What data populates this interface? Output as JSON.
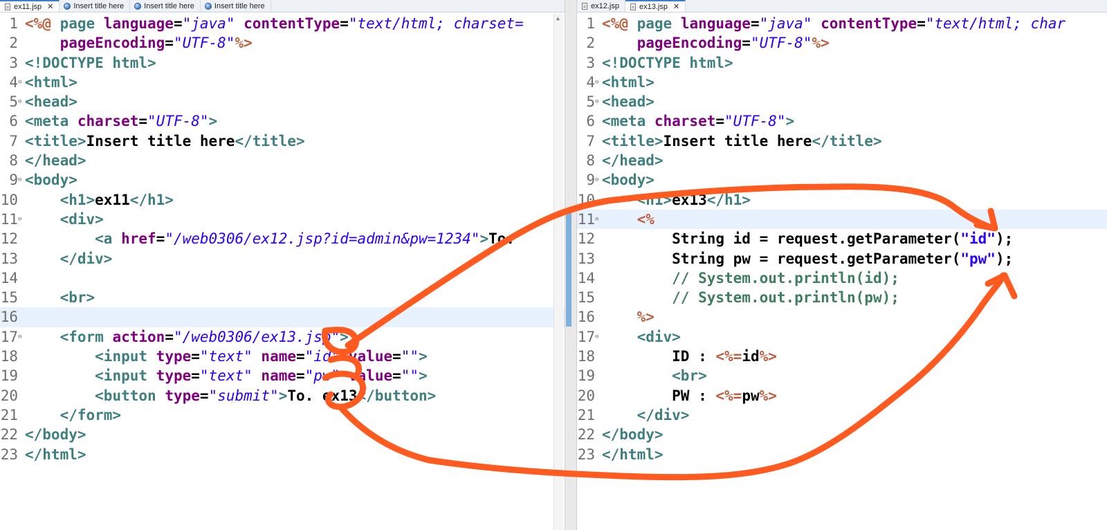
{
  "left_tabs": [
    {
      "label": "ex11.jsp",
      "icon": "jsp-file-icon",
      "active": true,
      "closable": true
    },
    {
      "label": "Insert title here",
      "icon": "browser-globe-icon"
    },
    {
      "label": "Insert title here",
      "icon": "browser-globe-icon"
    },
    {
      "label": "Insert title here",
      "icon": "browser-globe-icon"
    }
  ],
  "right_tabs": [
    {
      "label": "ex12.jsp",
      "icon": "jsp-file-icon"
    },
    {
      "label": "ex13.jsp",
      "icon": "jsp-file-icon",
      "active": true,
      "closable": true
    }
  ],
  "left_editor": {
    "highlight_line": 16,
    "lines": [
      {
        "n": "1",
        "fold": false,
        "tokens": [
          [
            "jsp",
            "<%@ "
          ],
          [
            "tg",
            "page "
          ],
          [
            "at",
            "language"
          ],
          [
            "tx",
            "="
          ],
          [
            "sv",
            "\"java\""
          ],
          [
            "tx",
            " "
          ],
          [
            "at",
            "contentType"
          ],
          [
            "tx",
            "="
          ],
          [
            "sv",
            "\"text/html; charset="
          ]
        ]
      },
      {
        "n": "2",
        "fold": false,
        "tokens": [
          [
            "tx",
            "    "
          ],
          [
            "at",
            "pageEncoding"
          ],
          [
            "tx",
            "="
          ],
          [
            "sv",
            "\"UTF-8\""
          ],
          [
            "jsp",
            "%>"
          ]
        ]
      },
      {
        "n": "3",
        "fold": false,
        "tokens": [
          [
            "tg",
            "<!DOCTYPE html>"
          ]
        ]
      },
      {
        "n": "4",
        "fold": true,
        "tokens": [
          [
            "tg",
            "<html>"
          ]
        ]
      },
      {
        "n": "5",
        "fold": true,
        "tokens": [
          [
            "tg",
            "<head>"
          ]
        ]
      },
      {
        "n": "6",
        "fold": false,
        "tokens": [
          [
            "tg",
            "<meta "
          ],
          [
            "at",
            "charset"
          ],
          [
            "tx",
            "="
          ],
          [
            "sv",
            "\"UTF-8\""
          ],
          [
            "tg",
            ">"
          ]
        ]
      },
      {
        "n": "7",
        "fold": false,
        "tokens": [
          [
            "tg",
            "<title>"
          ],
          [
            "tx",
            "Insert title here"
          ],
          [
            "tg",
            "</title>"
          ]
        ]
      },
      {
        "n": "8",
        "fold": false,
        "tokens": [
          [
            "tg",
            "</head>"
          ]
        ]
      },
      {
        "n": "9",
        "fold": true,
        "tokens": [
          [
            "tg",
            "<body>"
          ]
        ]
      },
      {
        "n": "10",
        "fold": false,
        "tokens": [
          [
            "tx",
            "    "
          ],
          [
            "tg",
            "<h1>"
          ],
          [
            "tx",
            "ex11"
          ],
          [
            "tg",
            "</h1>"
          ]
        ]
      },
      {
        "n": "11",
        "fold": true,
        "tokens": [
          [
            "tx",
            "    "
          ],
          [
            "tg",
            "<div>"
          ]
        ]
      },
      {
        "n": "12",
        "fold": false,
        "tokens": [
          [
            "tx",
            "        "
          ],
          [
            "tg",
            "<a "
          ],
          [
            "at",
            "href"
          ],
          [
            "tx",
            "="
          ],
          [
            "sv",
            "\"/web0306/ex12.jsp?id=admin&pw=1234\""
          ],
          [
            "tg",
            ">"
          ],
          [
            "tx",
            "To."
          ]
        ]
      },
      {
        "n": "13",
        "fold": false,
        "tokens": [
          [
            "tx",
            "    "
          ],
          [
            "tg",
            "</div>"
          ]
        ]
      },
      {
        "n": "14",
        "fold": false,
        "tokens": []
      },
      {
        "n": "15",
        "fold": false,
        "tokens": [
          [
            "tx",
            "    "
          ],
          [
            "tg",
            "<br>"
          ]
        ]
      },
      {
        "n": "16",
        "fold": false,
        "tokens": []
      },
      {
        "n": "17",
        "fold": true,
        "tokens": [
          [
            "tx",
            "    "
          ],
          [
            "tg",
            "<form "
          ],
          [
            "at",
            "action"
          ],
          [
            "tx",
            "="
          ],
          [
            "sv",
            "\"/web0306/ex13.jsp\""
          ],
          [
            "tg",
            ">"
          ]
        ]
      },
      {
        "n": "18",
        "fold": false,
        "tokens": [
          [
            "tx",
            "        "
          ],
          [
            "tg",
            "<input "
          ],
          [
            "at",
            "type"
          ],
          [
            "tx",
            "="
          ],
          [
            "sv",
            "\"text\""
          ],
          [
            "tx",
            " "
          ],
          [
            "at",
            "name"
          ],
          [
            "tx",
            "="
          ],
          [
            "sv",
            "\"id\""
          ],
          [
            "tx",
            " "
          ],
          [
            "at",
            "value"
          ],
          [
            "tx",
            "="
          ],
          [
            "sv",
            "\"\""
          ],
          [
            "tg",
            ">"
          ]
        ]
      },
      {
        "n": "19",
        "fold": false,
        "tokens": [
          [
            "tx",
            "        "
          ],
          [
            "tg",
            "<input "
          ],
          [
            "at",
            "type"
          ],
          [
            "tx",
            "="
          ],
          [
            "sv",
            "\"text\""
          ],
          [
            "tx",
            " "
          ],
          [
            "at",
            "name"
          ],
          [
            "tx",
            "="
          ],
          [
            "sv",
            "\"pw\""
          ],
          [
            "tx",
            " "
          ],
          [
            "at",
            "value"
          ],
          [
            "tx",
            "="
          ],
          [
            "sv",
            "\"\""
          ],
          [
            "tg",
            ">"
          ]
        ]
      },
      {
        "n": "20",
        "fold": false,
        "tokens": [
          [
            "tx",
            "        "
          ],
          [
            "tg",
            "<button "
          ],
          [
            "at",
            "type"
          ],
          [
            "tx",
            "="
          ],
          [
            "sv",
            "\"submit\""
          ],
          [
            "tg",
            ">"
          ],
          [
            "tx",
            "To. ex13"
          ],
          [
            "tg",
            "</button>"
          ]
        ]
      },
      {
        "n": "21",
        "fold": false,
        "tokens": [
          [
            "tx",
            "    "
          ],
          [
            "tg",
            "</form>"
          ]
        ]
      },
      {
        "n": "22",
        "fold": false,
        "tokens": [
          [
            "tg",
            "</body>"
          ]
        ]
      },
      {
        "n": "23",
        "fold": false,
        "tokens": [
          [
            "tg",
            "</html>"
          ]
        ]
      }
    ]
  },
  "right_editor": {
    "highlight_line": 11,
    "lines": [
      {
        "n": "1",
        "fold": false,
        "tokens": [
          [
            "jsp",
            "<%@ "
          ],
          [
            "tg",
            "page "
          ],
          [
            "at",
            "language"
          ],
          [
            "tx",
            "="
          ],
          [
            "sv",
            "\"java\""
          ],
          [
            "tx",
            " "
          ],
          [
            "at",
            "contentType"
          ],
          [
            "tx",
            "="
          ],
          [
            "sv",
            "\"text/html; char"
          ]
        ]
      },
      {
        "n": "2",
        "fold": false,
        "tokens": [
          [
            "tx",
            "    "
          ],
          [
            "at",
            "pageEncoding"
          ],
          [
            "tx",
            "="
          ],
          [
            "sv",
            "\"UTF-8\""
          ],
          [
            "jsp",
            "%>"
          ]
        ]
      },
      {
        "n": "3",
        "fold": false,
        "tokens": [
          [
            "tg",
            "<!DOCTYPE html>"
          ]
        ]
      },
      {
        "n": "4",
        "fold": true,
        "tokens": [
          [
            "tg",
            "<html>"
          ]
        ]
      },
      {
        "n": "5",
        "fold": true,
        "tokens": [
          [
            "tg",
            "<head>"
          ]
        ]
      },
      {
        "n": "6",
        "fold": false,
        "tokens": [
          [
            "tg",
            "<meta "
          ],
          [
            "at",
            "charset"
          ],
          [
            "tx",
            "="
          ],
          [
            "sv",
            "\"UTF-8\""
          ],
          [
            "tg",
            ">"
          ]
        ]
      },
      {
        "n": "7",
        "fold": false,
        "tokens": [
          [
            "tg",
            "<title>"
          ],
          [
            "tx",
            "Insert title here"
          ],
          [
            "tg",
            "</title>"
          ]
        ]
      },
      {
        "n": "8",
        "fold": false,
        "tokens": [
          [
            "tg",
            "</head>"
          ]
        ]
      },
      {
        "n": "9",
        "fold": true,
        "tokens": [
          [
            "tg",
            "<body>"
          ]
        ]
      },
      {
        "n": "10",
        "fold": false,
        "tokens": [
          [
            "tx",
            "    "
          ],
          [
            "tg",
            "<h1>"
          ],
          [
            "tx",
            "ex13"
          ],
          [
            "tg",
            "</h1>"
          ]
        ]
      },
      {
        "n": "11",
        "fold": true,
        "tokens": [
          [
            "tx",
            "    "
          ],
          [
            "jsp",
            "<%"
          ]
        ]
      },
      {
        "n": "12",
        "fold": false,
        "tokens": [
          [
            "tx",
            "        String id = request.getParameter("
          ],
          [
            "str",
            "\"id\""
          ],
          [
            "tx",
            ");"
          ]
        ]
      },
      {
        "n": "13",
        "fold": false,
        "tokens": [
          [
            "tx",
            "        String pw = request.getParameter("
          ],
          [
            "str",
            "\"pw\""
          ],
          [
            "tx",
            ");"
          ]
        ]
      },
      {
        "n": "14",
        "fold": false,
        "tokens": [
          [
            "tx",
            "        "
          ],
          [
            "cm",
            "// System.out.println(id);"
          ]
        ]
      },
      {
        "n": "15",
        "fold": false,
        "tokens": [
          [
            "tx",
            "        "
          ],
          [
            "cm",
            "// System.out.println(pw);"
          ]
        ]
      },
      {
        "n": "16",
        "fold": false,
        "tokens": [
          [
            "tx",
            "    "
          ],
          [
            "jsp",
            "%>"
          ]
        ]
      },
      {
        "n": "17",
        "fold": true,
        "tokens": [
          [
            "tx",
            "    "
          ],
          [
            "tg",
            "<div>"
          ]
        ]
      },
      {
        "n": "18",
        "fold": false,
        "tokens": [
          [
            "tx",
            "        ID : "
          ],
          [
            "jsp",
            "<%="
          ],
          [
            "tx",
            "id"
          ],
          [
            "jsp",
            "%>"
          ]
        ]
      },
      {
        "n": "19",
        "fold": false,
        "tokens": [
          [
            "tx",
            "        "
          ],
          [
            "tg",
            "<br>"
          ]
        ]
      },
      {
        "n": "20",
        "fold": false,
        "tokens": [
          [
            "tx",
            "        PW : "
          ],
          [
            "jsp",
            "<%="
          ],
          [
            "tx",
            "pw"
          ],
          [
            "jsp",
            "%>"
          ]
        ]
      },
      {
        "n": "21",
        "fold": false,
        "tokens": [
          [
            "tx",
            "    "
          ],
          [
            "tg",
            "</div>"
          ]
        ]
      },
      {
        "n": "22",
        "fold": false,
        "tokens": [
          [
            "tg",
            "</body>"
          ]
        ]
      },
      {
        "n": "23",
        "fold": false,
        "tokens": [
          [
            "tg",
            "</html>"
          ]
        ]
      }
    ]
  },
  "annotation": {
    "color": "#ff5a1f"
  }
}
